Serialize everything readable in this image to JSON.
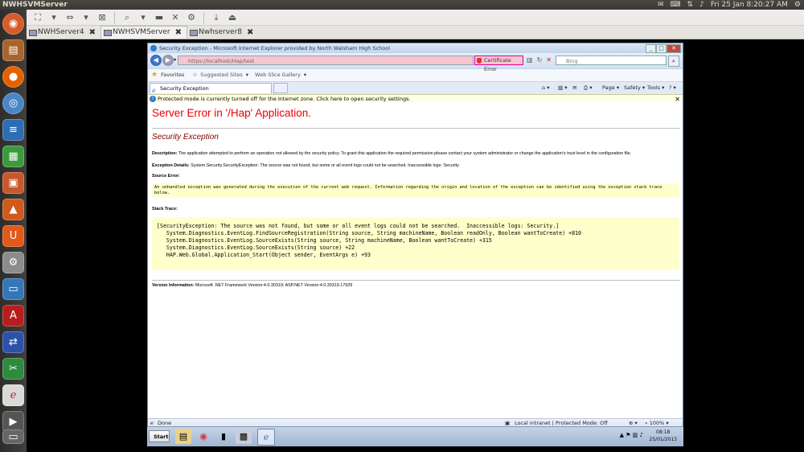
{
  "desktop": {
    "window_title": "NWHSVMServer",
    "clock": "Fri 25 Jan  8:20:27 AM"
  },
  "remmina": {
    "tabs": [
      {
        "label": "NWHServer4"
      },
      {
        "label": "NWHSVMServer"
      },
      {
        "label": "Nwhserver8"
      }
    ]
  },
  "ie": {
    "title": "Security Exception - Microsoft Internet Explorer provided by North Walsham High School",
    "url": "https://localhost/Hap/test",
    "cert_error": "Certificate Error",
    "search_placeholder": "Bing",
    "favorites_label": "Favorites",
    "suggested_sites": "Suggested Sites",
    "web_slice_gallery": "Web Slice Gallery",
    "tab_title": "Security Exception",
    "page_menu": "Page",
    "safety_menu": "Safety",
    "tools_menu": "Tools",
    "help_menu": "?",
    "infobar_text": "Protected mode is currently turned off for the Internet zone.  Click here to open security settings.",
    "status_done": "Done",
    "status_zone": "Local intranet | Protected Mode: Off",
    "zoom": "100%"
  },
  "page": {
    "heading": "Server Error in '/Hap' Application.",
    "subheading": "Security Exception",
    "description_label": "Description:",
    "description_text": "The application attempted to perform an operation not allowed by the security policy.  To grant this application the required permission please contact your system administrator or change the application's trust level in the configuration file.",
    "exception_label": "Exception Details:",
    "exception_text": "System.Security.SecurityException: The source was not found, but some or all event logs could not be searched.  Inaccessible logs: Security.",
    "source_error_label": "Source Error:",
    "source_error_text": "An unhandled exception was generated during the execution of the current web request. Information regarding the origin and location of the exception can be identified using the exception stack trace below.",
    "stack_trace_label": "Stack Trace:",
    "stack_trace": "[SecurityException: The source was not found, but some or all event logs could not be searched.  Inaccessible logs: Security.]\n   System.Diagnostics.EventLog.FindSourceRegistration(String source, String machineName, Boolean readOnly, Boolean wantToCreate) +810\n   System.Diagnostics.EventLog.SourceExists(String source, String machineName, Boolean wantToCreate) +315\n   System.Diagnostics.EventLog.SourceExists(String source) +22\n   HAP.Web.Global.Application_Start(Object sender, EventArgs e) +93",
    "version_label": "Version Information:",
    "version_text": "Microsoft .NET Framework Version:4.0.30319; ASP.NET Version:4.0.30319.17929"
  },
  "windows_taskbar": {
    "start_label": "Start",
    "time": "08:18",
    "date": "25/01/2013"
  },
  "colors": {
    "heading_red": "#ee0000",
    "subheading_maroon": "#800000",
    "code_background": "#ffffcc",
    "cert_error_pink": "#f7c5cf"
  }
}
